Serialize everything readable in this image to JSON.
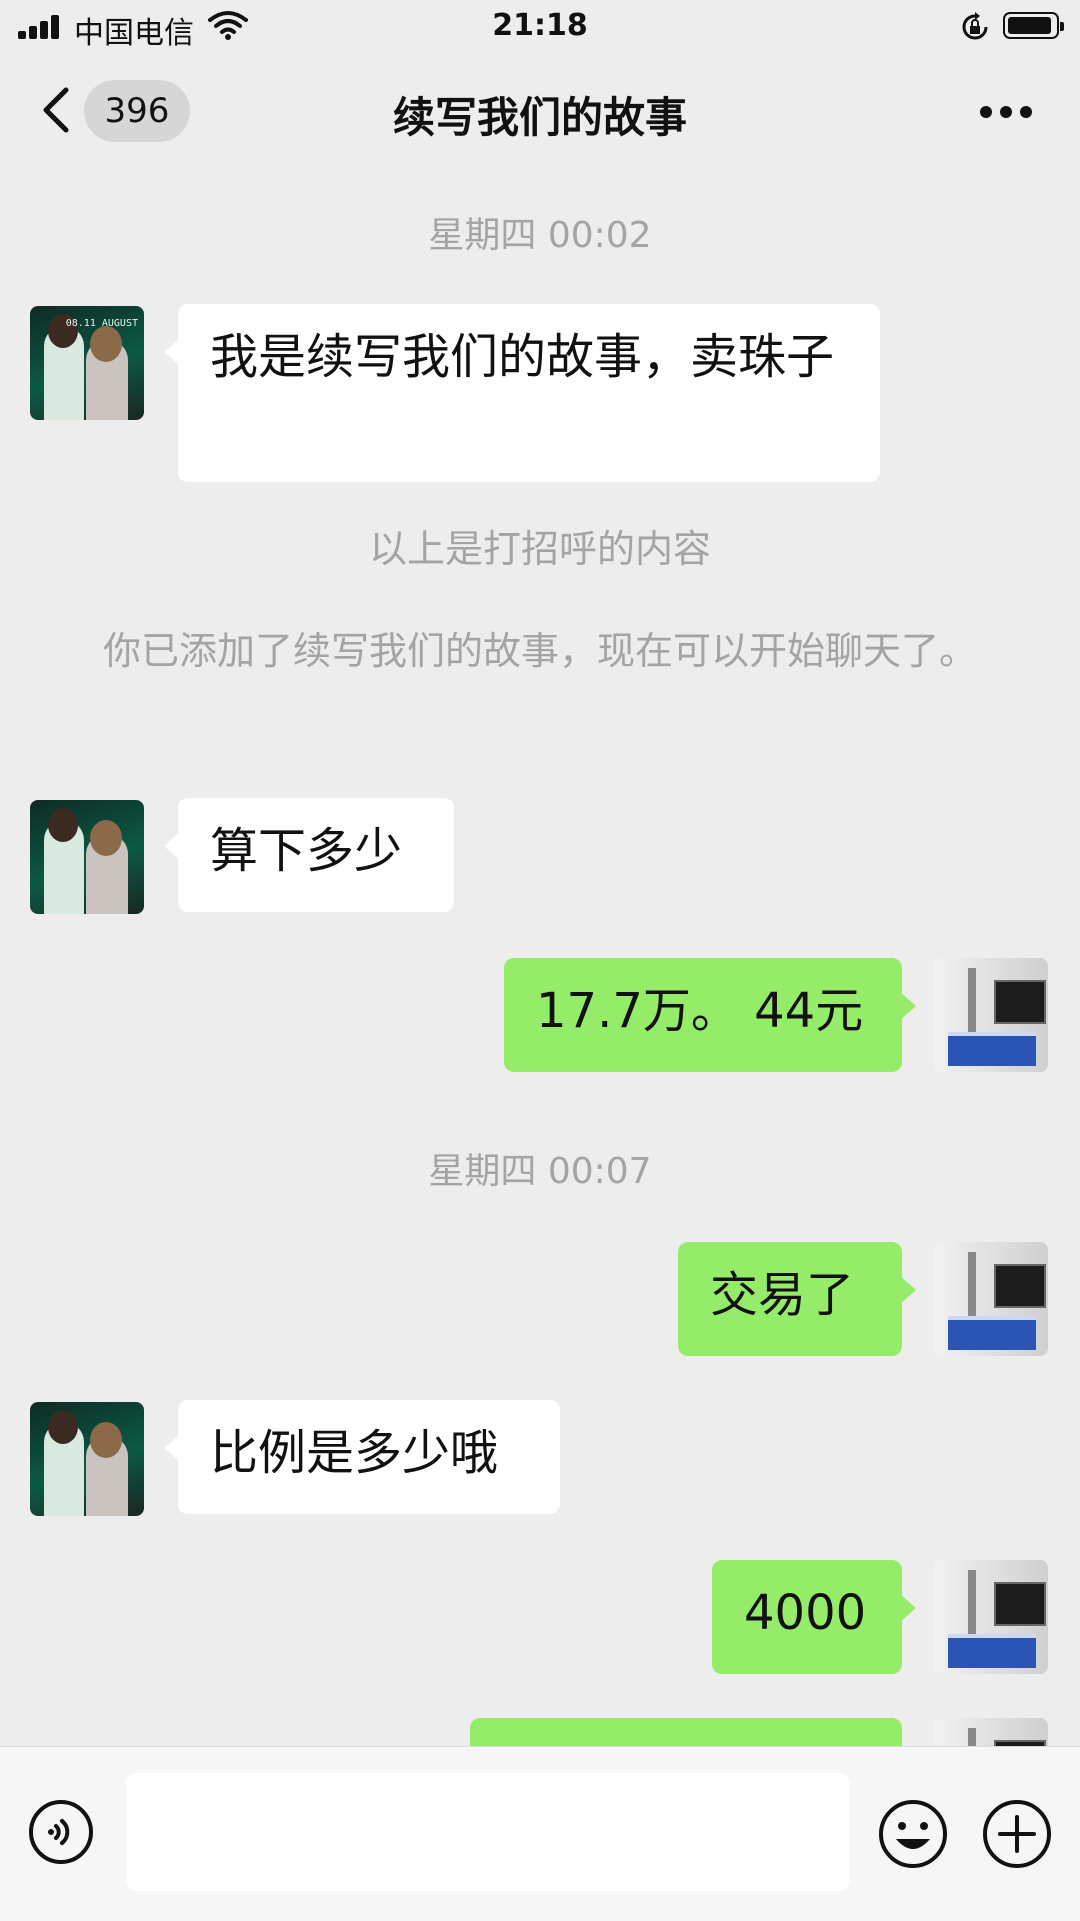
{
  "status_bar": {
    "carrier": "中国电信",
    "time": "21:18"
  },
  "nav": {
    "unread_count": "396",
    "title": "续写我们的故事"
  },
  "messages": [
    {
      "type": "time",
      "text": "星期四 00:02"
    },
    {
      "type": "in",
      "text": "我是续写我们的故事，卖珠子"
    },
    {
      "type": "system",
      "text": "以上是打招呼的内容"
    },
    {
      "type": "system",
      "text": "你已添加了续写我们的故事，现在可以开始聊天了。"
    },
    {
      "type": "in",
      "text": "算下多少"
    },
    {
      "type": "out",
      "text": "17.7万。 44元"
    },
    {
      "type": "time",
      "text": "星期四 00:07"
    },
    {
      "type": "out",
      "text": "交易了"
    },
    {
      "type": "in",
      "text": "比例是多少哦"
    },
    {
      "type": "out",
      "text": "4000"
    }
  ],
  "contact_avatar_tag": "08.11 AUGUST",
  "input": {
    "placeholder": ""
  },
  "colors": {
    "background": "#ededed",
    "outgoing_bubble": "#95ec69",
    "incoming_bubble": "#ffffff"
  },
  "icons": [
    "signal-icon",
    "wifi-icon",
    "rotation-lock-icon",
    "battery-icon",
    "back-chevron-icon",
    "more-icon",
    "voice-icon",
    "emoji-icon",
    "plus-icon"
  ]
}
